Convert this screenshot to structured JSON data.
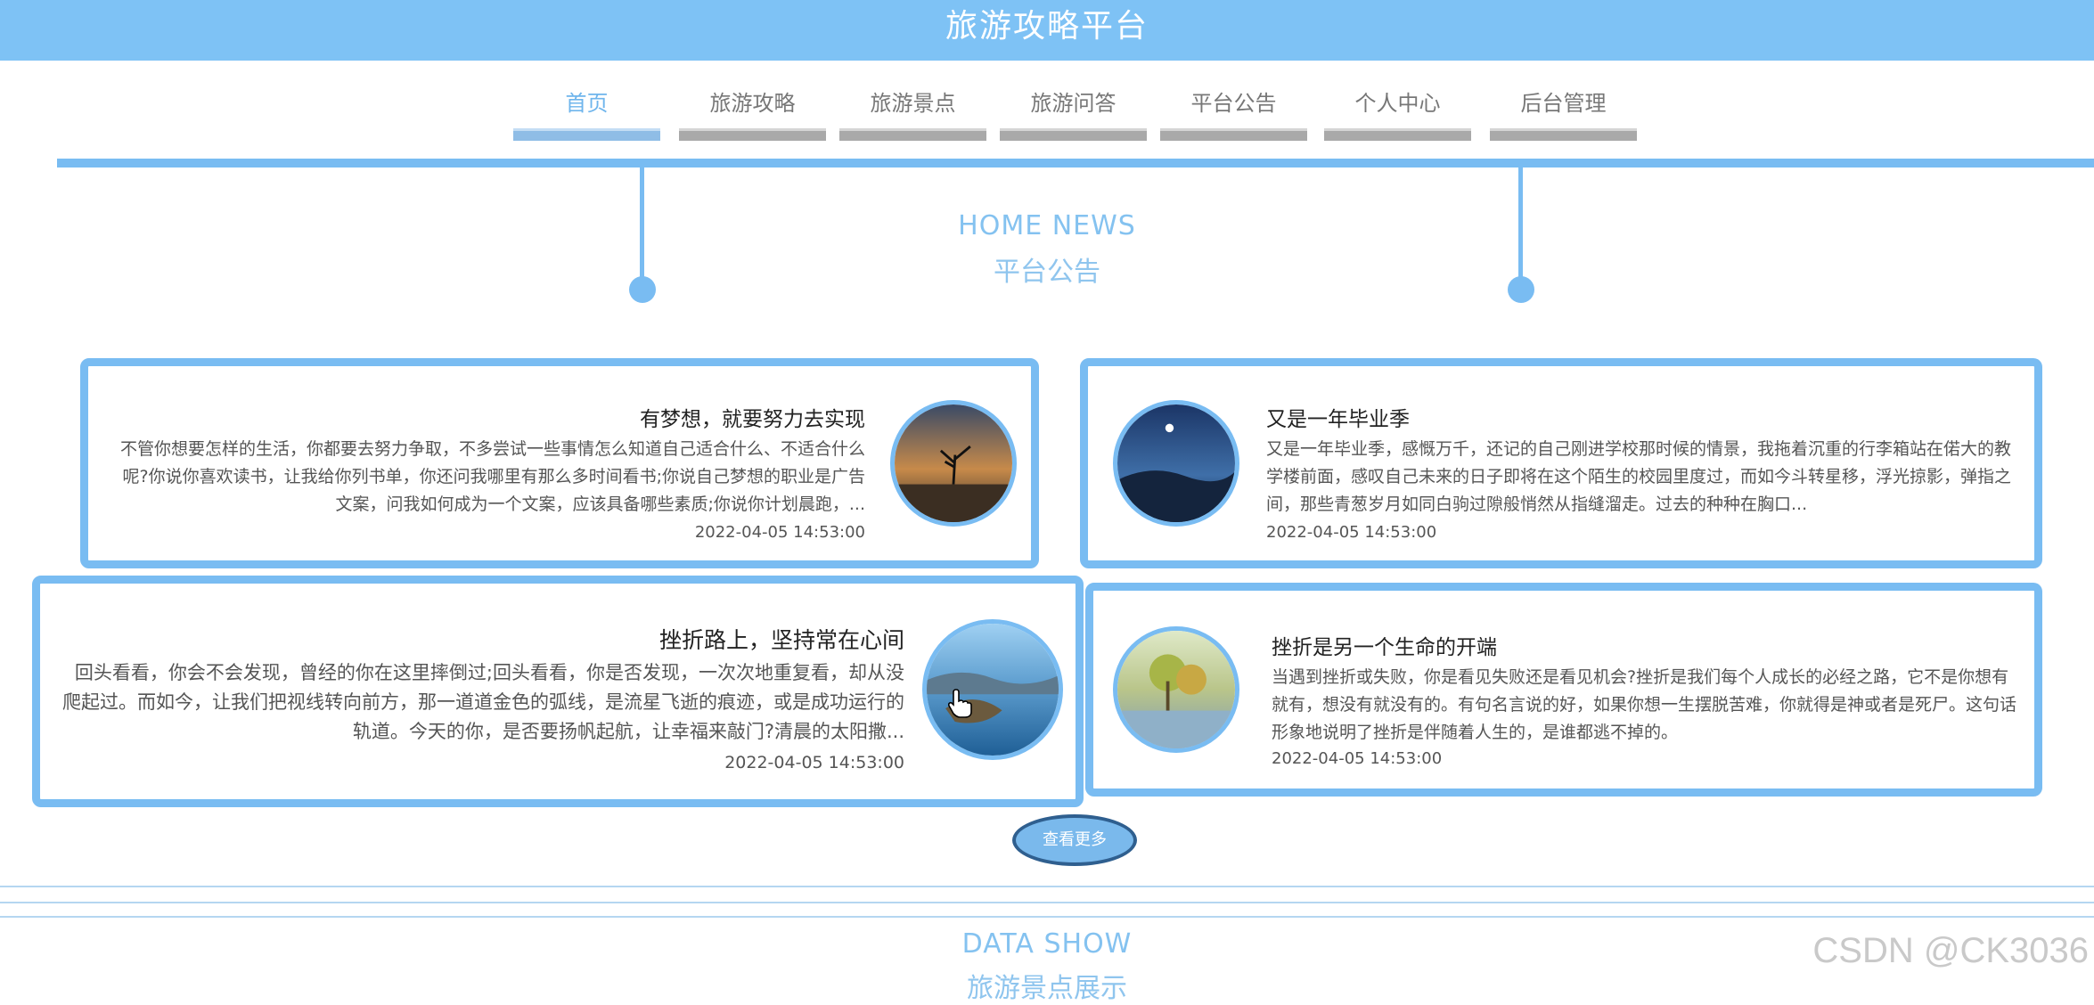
{
  "header": {
    "title": "旅游攻略平台"
  },
  "nav": {
    "items": [
      {
        "label": "首页",
        "active": true
      },
      {
        "label": "旅游攻略",
        "active": false
      },
      {
        "label": "旅游景点",
        "active": false
      },
      {
        "label": "旅游问答",
        "active": false
      },
      {
        "label": "平台公告",
        "active": false
      },
      {
        "label": "个人中心",
        "active": false
      },
      {
        "label": "后台管理",
        "active": false
      }
    ]
  },
  "news": {
    "title_en": "HOME NEWS",
    "title_cn": "平台公告",
    "cards": [
      {
        "title": "有梦想，就要努力去实现",
        "text": "不管你想要怎样的生活，你都要去努力争取，不多尝试一些事情怎么知道自己适合什么、不适合什么呢?你说你喜欢读书，让我给你列书单，你还问我哪里有那么多时间看书;你说自己梦想的职业是广告文案，问我如何成为一个文案，应该具备哪些素质;你说你计划晨跑，...",
        "date": "2022-04-05 14:53:00"
      },
      {
        "title": "又是一年毕业季",
        "text": "又是一年毕业季，感慨万千，还记的自己刚进学校那时候的情景，我拖着沉重的行李箱站在偌大的教学楼前面，感叹自己未来的日子即将在这个陌生的校园里度过，而如今斗转星移，浮光掠影，弹指之间，那些青葱岁月如同白驹过隙般悄然从指缝溜走。过去的种种在胸口...",
        "date": "2022-04-05 14:53:00"
      },
      {
        "title": "挫折路上，坚持常在心间",
        "text": "回头看看，你会不会发现，曾经的你在这里摔倒过;回头看看，你是否发现，一次次地重复看，却从没爬起过。而如今，让我们把视线转向前方，那一道道金色的弧线，是流星飞逝的痕迹，或是成功运行的轨道。今天的你，是否要扬帆起航，让幸福来敲门?清晨的太阳撒...",
        "date": "2022-04-05 14:53:00"
      },
      {
        "title": "挫折是另一个生命的开端",
        "text": "当遇到挫折或失败，你是看见失败还是看见机会?挫折是我们每个人成长的必经之路，它不是你想有就有，想没有就没有的。有句名言说的好，如果你想一生摆脱苦难，你就得是神或者是死尸。这句话形象地说明了挫折是伴随着人生的，是谁都逃不掉的。",
        "date": "2022-04-05 14:53:00"
      }
    ],
    "more_label": "查看更多"
  },
  "data_show": {
    "title_en": "DATA SHOW",
    "title_cn": "旅游景点展示"
  },
  "watermark": "CSDN @CK3036",
  "colors": {
    "primary": "#7ec2f5",
    "border": "#79bcf2",
    "nav_bar": "#a9a9a9"
  }
}
